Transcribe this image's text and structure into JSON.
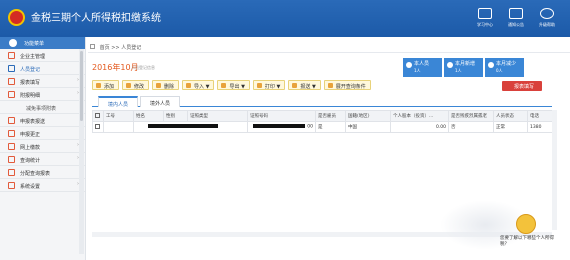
{
  "header": {
    "title": "金税三期个人所得税扣缴系统",
    "buttons": [
      {
        "label": "学习中心",
        "icon": "study-center-icon"
      },
      {
        "label": "通知公告",
        "icon": "notice-icon"
      },
      {
        "label": "升级帮助",
        "icon": "help-icon"
      }
    ]
  },
  "sidebar": {
    "header": "功能菜单",
    "items": [
      {
        "label": "企业主管理",
        "icon": "building-icon",
        "arrow": ""
      },
      {
        "label": "人员登记",
        "icon": "person-register-icon",
        "arrow": "",
        "active": true
      },
      {
        "label": "报表填写",
        "icon": "form-fill-icon",
        "arrow": "›"
      },
      {
        "label": "附报明细",
        "icon": "attachment-icon",
        "arrow": "›"
      },
      {
        "label": "减免事项附表",
        "icon": "",
        "arrow": "",
        "sub": true
      },
      {
        "label": "申报表报送",
        "icon": "submit-icon",
        "arrow": ""
      },
      {
        "label": "申报更正",
        "icon": "correct-icon",
        "arrow": ""
      },
      {
        "label": "网上缴款",
        "icon": "payment-icon",
        "arrow": "›"
      },
      {
        "label": "查询统计",
        "icon": "query-icon",
        "arrow": "›"
      },
      {
        "label": "分配查询报表",
        "icon": "report-icon",
        "arrow": ""
      },
      {
        "label": "系统设置",
        "icon": "settings-icon",
        "arrow": "›"
      }
    ]
  },
  "breadcrumb": {
    "home": "首页",
    "separator": ">>",
    "current": "人员登记"
  },
  "page": {
    "period": "2016年10月",
    "subtitle": "人员登记信息",
    "report_button": "报表填写",
    "stats": [
      {
        "label": "本人员",
        "value": "1人",
        "color": "#3a86d6"
      },
      {
        "label": "本月新增",
        "value": "1人",
        "color": "#3a86d6"
      },
      {
        "label": "本月减少",
        "value": "0人",
        "color": "#3a86d6"
      }
    ]
  },
  "toolbar": {
    "buttons": [
      "添加",
      "修改",
      "删除",
      "导入 ▼",
      "导出 ▼",
      "打印 ▼",
      "报送 ▼",
      "展开查询条件"
    ]
  },
  "tabs": [
    "境内人员",
    "境外人员"
  ],
  "table": {
    "columns": [
      "",
      "工号",
      "姓名",
      "性别",
      "证照类型",
      "证照号码",
      "是否雇员",
      "国籍(地区)",
      "个人股本（投资）...",
      "是否残疾烈属孤老",
      "人员状态",
      "电话"
    ],
    "rows": [
      {
        "checkbox": true,
        "id": "",
        "name": "",
        "gender": "",
        "id_type": "",
        "id_number": "00",
        "employee": "是",
        "nationality": "中国",
        "shares": "0.00",
        "disabled": "否",
        "status": "正常",
        "phone": "1380"
      }
    ]
  },
  "assistant": {
    "text": "您要了解以下哪些个人所得税？"
  }
}
